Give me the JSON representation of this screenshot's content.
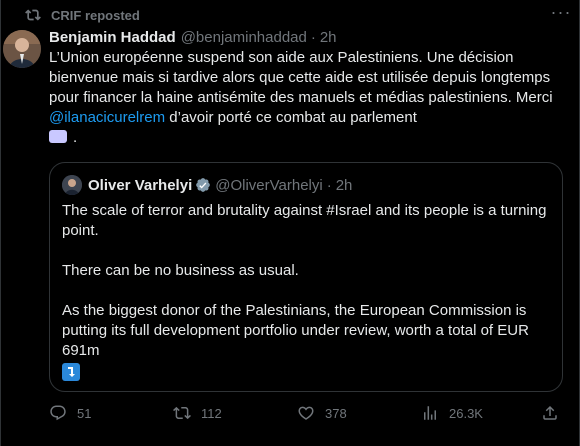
{
  "repost": {
    "label": "CRIF reposted"
  },
  "tweet": {
    "author_name": "Benjamin Haddad",
    "author_handle": "@benjaminhaddad",
    "separator": "·",
    "time": "2h",
    "more_label": "···",
    "text_before_mention": "L’Union européenne suspend son aide aux Palestiniens. Une décision bienvenue mais si tardive alors que cette aide est utilisée depuis longtemps pour financer la haine antisémite des manuels et médias palestiniens. Merci ",
    "mention": "@ilanacicurelrem",
    "text_after_mention": " d’avoir porté ce combat au parlement",
    "text_end": "."
  },
  "quote": {
    "author_name": "Oliver Varhelyi",
    "author_handle": "@OliverVarhelyi",
    "separator": "·",
    "time": "2h",
    "paragraphs": [
      "The scale of terror and brutality against #Israel and its people is a turning point.",
      "There can be no business as usual.",
      "As the biggest donor of the Palestinians, the European Commission is putting its full development portfolio under review, worth a total of EUR 691m"
    ]
  },
  "actions": {
    "replies": "51",
    "reposts": "112",
    "likes": "378",
    "views": "26.3K"
  },
  "colors": {
    "background": "#000000",
    "text": "#e7e9ea",
    "muted": "#71767b",
    "link": "#1d9bf0",
    "border": "#2f3336"
  }
}
